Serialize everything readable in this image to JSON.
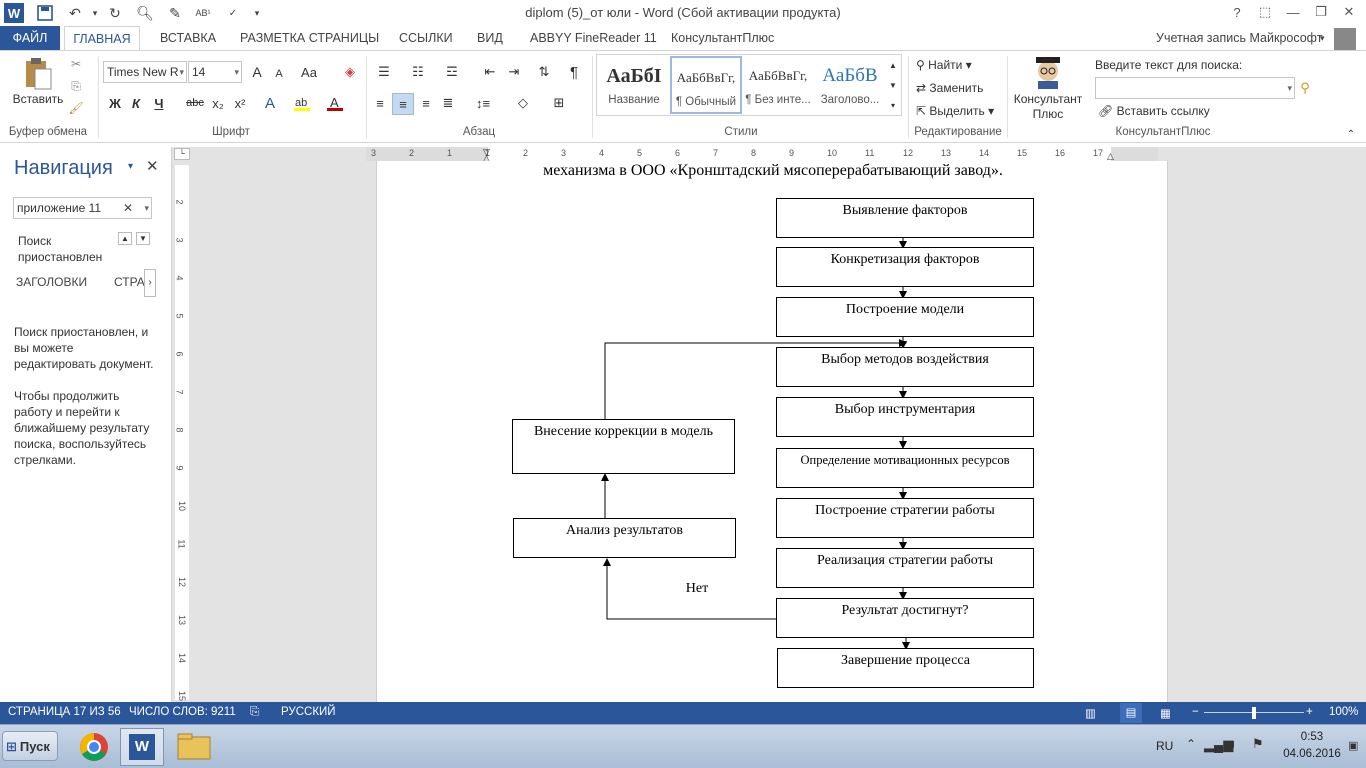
{
  "title_bar": {
    "doc_title": "diplom (5)_от юли - Word (Сбой активации продукта)",
    "help": "?"
  },
  "ribbon_tabs": [
    "ФАЙЛ",
    "ГЛАВНАЯ",
    "ВСТАВКА",
    "РАЗМЕТКА СТРАНИЦЫ",
    "ССЫЛКИ",
    "ВИД",
    "ABBYY FineReader 11",
    "КонсультантПлюс"
  ],
  "account": "Учетная запись Майкрософт",
  "ribbon": {
    "clipboard": {
      "paste": "Вставить",
      "group": "Буфер обмена"
    },
    "font": {
      "name": "Times New R",
      "size": "14",
      "group": "Шрифт",
      "bold": "Ж",
      "italic": "К",
      "underline": "Ч",
      "strike": "abc",
      "sub": "x₂",
      "sup": "x²",
      "case": "Aa",
      "grow": "A",
      "shrink": "A"
    },
    "paragraph": {
      "group": "Абзац"
    },
    "styles": {
      "group": "Стили",
      "items": [
        {
          "sample": "АаБбІ",
          "caption": "Название"
        },
        {
          "sample": "АаБбВвГг,",
          "caption": "¶ Обычный"
        },
        {
          "sample": "АаБбВвГг,",
          "caption": "¶ Без инте..."
        },
        {
          "sample": "АаБбВ",
          "caption": "Заголово..."
        }
      ]
    },
    "editing": {
      "group": "Редактирование",
      "find": "Найти",
      "replace": "Заменить",
      "select": "Выделить"
    },
    "consultant": {
      "group": "КонсультантПлюс",
      "btn": "Консультант Плюс",
      "search_label": "Введите текст для поиска:",
      "insert_link": "Вставить ссылку"
    }
  },
  "navigation": {
    "title": "Навигация",
    "search_value": "приложение 11",
    "search_status": "Поиск приостановлен",
    "tab_headings": "ЗАГОЛОВКИ",
    "tab_pages": "СТРА",
    "msg1": "Поиск приостановлен, и вы можете редактировать документ.",
    "msg2": "Чтобы продолжить работу и перейти к ближайшему результату поиска, воспользуйтесь стрелками."
  },
  "ruler": {
    "h": [
      "3",
      "2",
      "1",
      "1",
      "2",
      "3",
      "4",
      "5",
      "6",
      "7",
      "8",
      "9",
      "10",
      "11",
      "12",
      "13",
      "14",
      "15",
      "16",
      "17"
    ],
    "v": [
      "2",
      "3",
      "4",
      "5",
      "6",
      "7",
      "8",
      "9",
      "10",
      "11",
      "12",
      "13",
      "14",
      "15"
    ]
  },
  "document": {
    "heading": "механизма в ООО «Кронштадский мясоперерабатывающий завод».",
    "flow": [
      "Выявление факторов",
      "Конкретизация факторов",
      "Построение модели",
      "Выбор методов воздействия",
      "Выбор инструментария",
      "Определение мотивационных ресурсов",
      "Построение стратегии работы",
      "Реализация стратегии работы",
      "Результат достигнут?",
      "Завершение процесса"
    ],
    "correction": "Внесение коррекции в модель",
    "analysis": "Анализ результатов",
    "no": "Нет"
  },
  "status": {
    "page": "СТРАНИЦА 17 ИЗ 56",
    "words": "ЧИСЛО СЛОВ: 9211",
    "lang": "РУССКИЙ",
    "zoom": "100%",
    "zoom_level": 0.5
  },
  "taskbar": {
    "start": "Пуск",
    "lang": "RU",
    "time": "0:53",
    "date": "04.06.2016"
  },
  "colors": {
    "accent": "#2b579a",
    "selected_style": "#c5d9f1"
  }
}
